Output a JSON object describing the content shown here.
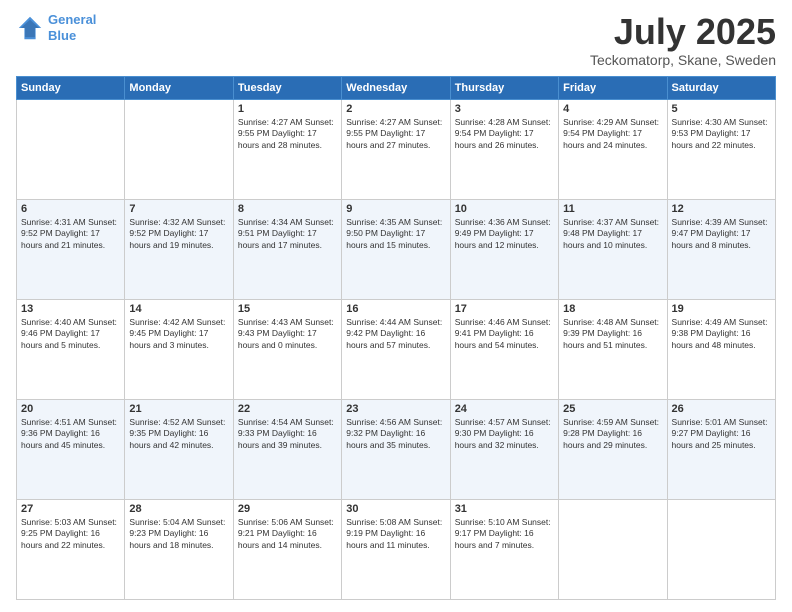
{
  "header": {
    "logo_line1": "General",
    "logo_line2": "Blue",
    "month_title": "July 2025",
    "subtitle": "Teckomatorp, Skane, Sweden"
  },
  "days_of_week": [
    "Sunday",
    "Monday",
    "Tuesday",
    "Wednesday",
    "Thursday",
    "Friday",
    "Saturday"
  ],
  "weeks": [
    [
      {
        "day": "",
        "content": ""
      },
      {
        "day": "",
        "content": ""
      },
      {
        "day": "1",
        "content": "Sunrise: 4:27 AM\nSunset: 9:55 PM\nDaylight: 17 hours and 28 minutes."
      },
      {
        "day": "2",
        "content": "Sunrise: 4:27 AM\nSunset: 9:55 PM\nDaylight: 17 hours and 27 minutes."
      },
      {
        "day": "3",
        "content": "Sunrise: 4:28 AM\nSunset: 9:54 PM\nDaylight: 17 hours and 26 minutes."
      },
      {
        "day": "4",
        "content": "Sunrise: 4:29 AM\nSunset: 9:54 PM\nDaylight: 17 hours and 24 minutes."
      },
      {
        "day": "5",
        "content": "Sunrise: 4:30 AM\nSunset: 9:53 PM\nDaylight: 17 hours and 22 minutes."
      }
    ],
    [
      {
        "day": "6",
        "content": "Sunrise: 4:31 AM\nSunset: 9:52 PM\nDaylight: 17 hours and 21 minutes."
      },
      {
        "day": "7",
        "content": "Sunrise: 4:32 AM\nSunset: 9:52 PM\nDaylight: 17 hours and 19 minutes."
      },
      {
        "day": "8",
        "content": "Sunrise: 4:34 AM\nSunset: 9:51 PM\nDaylight: 17 hours and 17 minutes."
      },
      {
        "day": "9",
        "content": "Sunrise: 4:35 AM\nSunset: 9:50 PM\nDaylight: 17 hours and 15 minutes."
      },
      {
        "day": "10",
        "content": "Sunrise: 4:36 AM\nSunset: 9:49 PM\nDaylight: 17 hours and 12 minutes."
      },
      {
        "day": "11",
        "content": "Sunrise: 4:37 AM\nSunset: 9:48 PM\nDaylight: 17 hours and 10 minutes."
      },
      {
        "day": "12",
        "content": "Sunrise: 4:39 AM\nSunset: 9:47 PM\nDaylight: 17 hours and 8 minutes."
      }
    ],
    [
      {
        "day": "13",
        "content": "Sunrise: 4:40 AM\nSunset: 9:46 PM\nDaylight: 17 hours and 5 minutes."
      },
      {
        "day": "14",
        "content": "Sunrise: 4:42 AM\nSunset: 9:45 PM\nDaylight: 17 hours and 3 minutes."
      },
      {
        "day": "15",
        "content": "Sunrise: 4:43 AM\nSunset: 9:43 PM\nDaylight: 17 hours and 0 minutes."
      },
      {
        "day": "16",
        "content": "Sunrise: 4:44 AM\nSunset: 9:42 PM\nDaylight: 16 hours and 57 minutes."
      },
      {
        "day": "17",
        "content": "Sunrise: 4:46 AM\nSunset: 9:41 PM\nDaylight: 16 hours and 54 minutes."
      },
      {
        "day": "18",
        "content": "Sunrise: 4:48 AM\nSunset: 9:39 PM\nDaylight: 16 hours and 51 minutes."
      },
      {
        "day": "19",
        "content": "Sunrise: 4:49 AM\nSunset: 9:38 PM\nDaylight: 16 hours and 48 minutes."
      }
    ],
    [
      {
        "day": "20",
        "content": "Sunrise: 4:51 AM\nSunset: 9:36 PM\nDaylight: 16 hours and 45 minutes."
      },
      {
        "day": "21",
        "content": "Sunrise: 4:52 AM\nSunset: 9:35 PM\nDaylight: 16 hours and 42 minutes."
      },
      {
        "day": "22",
        "content": "Sunrise: 4:54 AM\nSunset: 9:33 PM\nDaylight: 16 hours and 39 minutes."
      },
      {
        "day": "23",
        "content": "Sunrise: 4:56 AM\nSunset: 9:32 PM\nDaylight: 16 hours and 35 minutes."
      },
      {
        "day": "24",
        "content": "Sunrise: 4:57 AM\nSunset: 9:30 PM\nDaylight: 16 hours and 32 minutes."
      },
      {
        "day": "25",
        "content": "Sunrise: 4:59 AM\nSunset: 9:28 PM\nDaylight: 16 hours and 29 minutes."
      },
      {
        "day": "26",
        "content": "Sunrise: 5:01 AM\nSunset: 9:27 PM\nDaylight: 16 hours and 25 minutes."
      }
    ],
    [
      {
        "day": "27",
        "content": "Sunrise: 5:03 AM\nSunset: 9:25 PM\nDaylight: 16 hours and 22 minutes."
      },
      {
        "day": "28",
        "content": "Sunrise: 5:04 AM\nSunset: 9:23 PM\nDaylight: 16 hours and 18 minutes."
      },
      {
        "day": "29",
        "content": "Sunrise: 5:06 AM\nSunset: 9:21 PM\nDaylight: 16 hours and 14 minutes."
      },
      {
        "day": "30",
        "content": "Sunrise: 5:08 AM\nSunset: 9:19 PM\nDaylight: 16 hours and 11 minutes."
      },
      {
        "day": "31",
        "content": "Sunrise: 5:10 AM\nSunset: 9:17 PM\nDaylight: 16 hours and 7 minutes."
      },
      {
        "day": "",
        "content": ""
      },
      {
        "day": "",
        "content": ""
      }
    ]
  ]
}
